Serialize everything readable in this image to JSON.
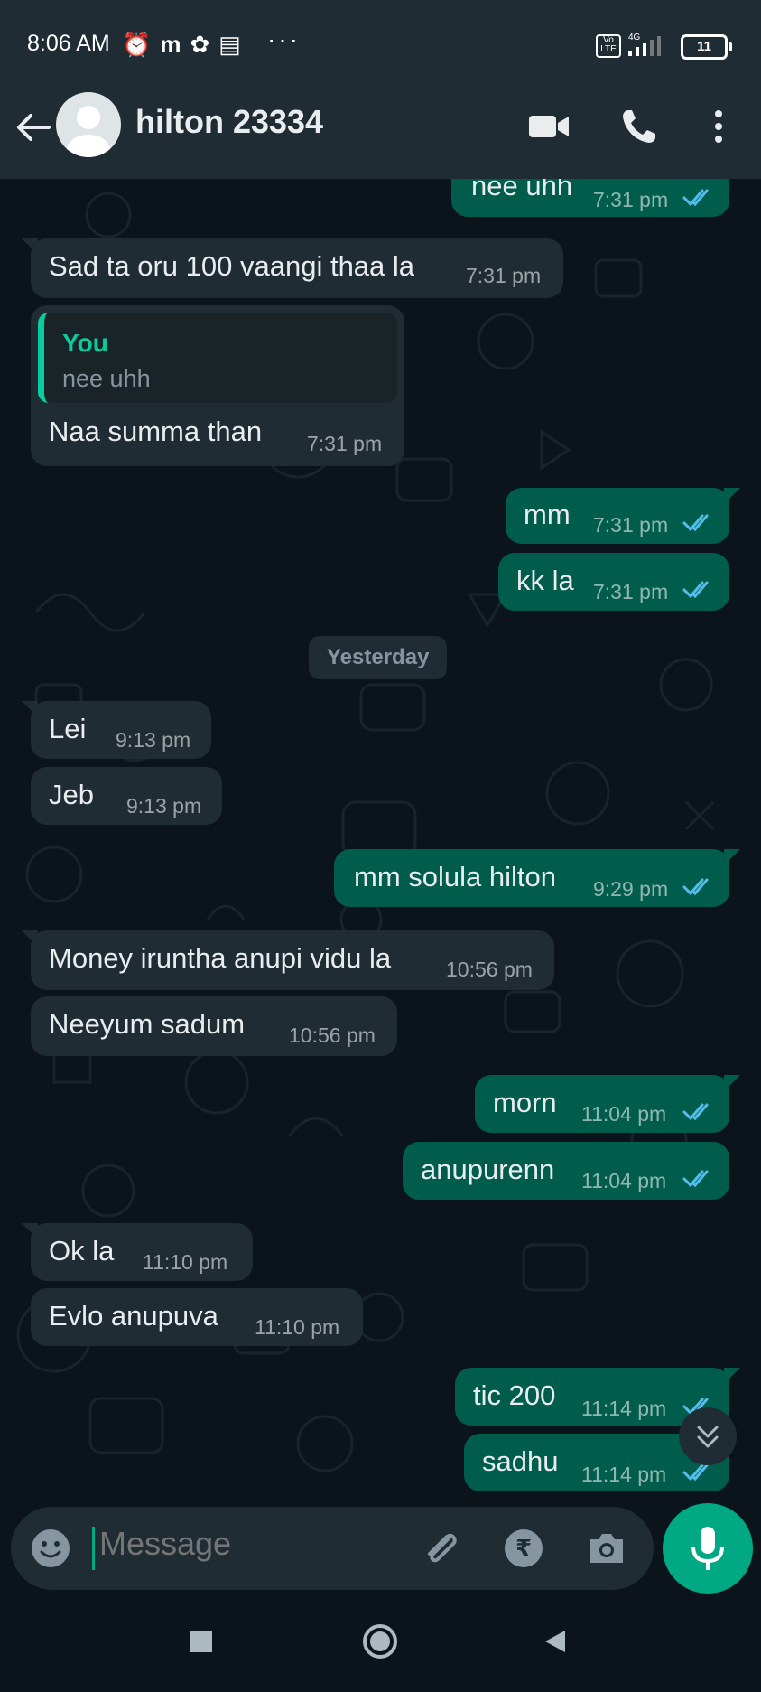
{
  "status_bar": {
    "time": "8:06 AM",
    "icons": [
      "alarm-icon",
      "m-app-icon",
      "pinwheel-icon",
      "notes-icon"
    ],
    "more": "···",
    "network": "4G",
    "battery": "11"
  },
  "header": {
    "contact_name": "hilton 23334",
    "icons": [
      "back-arrow-icon",
      "avatar",
      "video-call-icon",
      "voice-call-icon",
      "more-options-icon"
    ]
  },
  "messages": [
    {
      "dir": "out",
      "text": "nee uhh",
      "time": "7:31 pm",
      "read": true
    },
    {
      "dir": "in",
      "text": "Sad ta oru 100 vaangi thaa la",
      "time": "7:31 pm"
    },
    {
      "dir": "in",
      "quote": {
        "author": "You",
        "text": "nee uhh"
      },
      "text": "Naa summa than",
      "time": "7:31 pm"
    },
    {
      "dir": "out",
      "text": "mm",
      "time": "7:31 pm",
      "read": true
    },
    {
      "dir": "out",
      "text": "kk la",
      "time": "7:31 pm",
      "read": true
    },
    {
      "dir": "in",
      "text": "Lei",
      "time": "9:13 pm"
    },
    {
      "dir": "in",
      "text": "Jeb",
      "time": "9:13 pm"
    },
    {
      "dir": "out",
      "text": "mm solula hilton",
      "time": "9:29 pm",
      "read": true
    },
    {
      "dir": "in",
      "text": "Money iruntha anupi vidu la",
      "time": "10:56 pm"
    },
    {
      "dir": "in",
      "text": "Neeyum sadum",
      "time": "10:56 pm"
    },
    {
      "dir": "out",
      "text": "morn",
      "time": "11:04 pm",
      "read": true
    },
    {
      "dir": "out",
      "text": "anupurenn",
      "time": "11:04 pm",
      "read": true
    },
    {
      "dir": "in",
      "text": "Ok la",
      "time": "11:10 pm"
    },
    {
      "dir": "in",
      "text": "Evlo anupuva",
      "time": "11:10 pm"
    },
    {
      "dir": "out",
      "text": "tic 200",
      "time": "11:14 pm",
      "read": true
    },
    {
      "dir": "out",
      "text": "sadhu",
      "time": "11:14 pm",
      "read": true
    }
  ],
  "date_divider": "Yesterday",
  "composer": {
    "placeholder": "Message",
    "icons": [
      "emoji-icon",
      "attach-icon",
      "rupee-payment-icon",
      "camera-icon",
      "mic-icon"
    ]
  },
  "nav_bar": {
    "icons": [
      "recents-icon",
      "home-icon",
      "back-icon"
    ]
  },
  "colors": {
    "background": "#0b141a",
    "header": "#1f2c34",
    "incoming_bubble": "#1f2c34",
    "outgoing_bubble": "#005c4b",
    "accent": "#00a884",
    "read_tick": "#53bdeb"
  }
}
